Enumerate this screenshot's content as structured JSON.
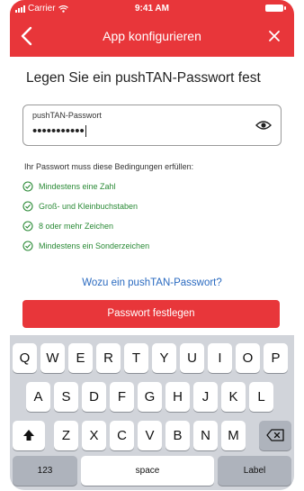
{
  "status_bar": {
    "carrier": "Carrier",
    "time": "9:41 AM"
  },
  "nav": {
    "title": "App konfigurieren"
  },
  "form": {
    "heading": "Legen Sie ein pushTAN-Passwort fest",
    "password_label": "pushTAN-Passwort",
    "password_value": "•••••••••••",
    "conditions_heading": "Ihr Passwort muss diese Bedingungen erfüllen:",
    "conditions": [
      "Mindestens eine Zahl",
      "Groß- und Kleinbuchstaben",
      "8 oder mehr Zeichen",
      "Mindestens ein Sonderzeichen"
    ],
    "help_link": "Wozu ein pushTAN-Passwort?",
    "submit_label": "Passwort festlegen"
  },
  "keyboard": {
    "row1": [
      "Q",
      "W",
      "E",
      "R",
      "T",
      "Y",
      "U",
      "I",
      "O",
      "P"
    ],
    "row2": [
      "A",
      "S",
      "D",
      "F",
      "G",
      "H",
      "J",
      "K",
      "L"
    ],
    "row3": [
      "Z",
      "X",
      "C",
      "V",
      "B",
      "N",
      "M"
    ],
    "numbers_key": "123",
    "space_key": "space",
    "return_key": "Label"
  },
  "colors": {
    "brand": "#e8363a",
    "success": "#2a8a36",
    "link": "#2a6ac0"
  }
}
